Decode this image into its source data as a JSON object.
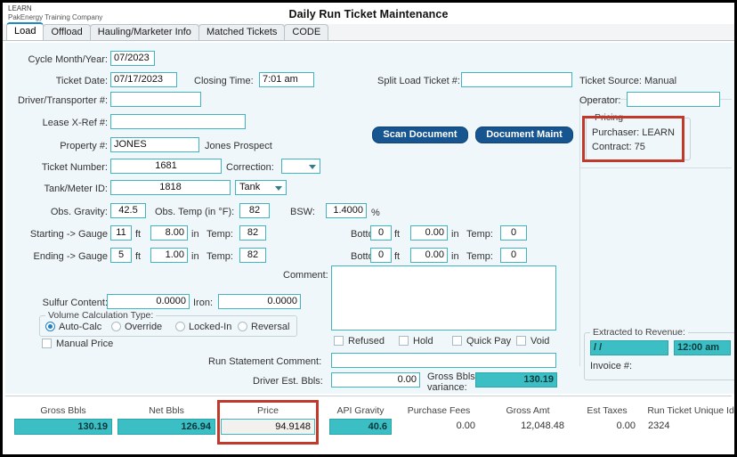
{
  "header": {
    "company_code": "LEARN",
    "company_name": "PakEnergy Training Company",
    "title": "Daily Run Ticket Maintenance"
  },
  "tabs": [
    {
      "label": "Load",
      "active": true
    },
    {
      "label": "Offload",
      "active": false
    },
    {
      "label": "Hauling/Marketer Info",
      "active": false
    },
    {
      "label": "Matched Tickets",
      "active": false
    },
    {
      "label": "CODE",
      "active": false
    }
  ],
  "form": {
    "cycle_month_year_label": "Cycle Month/Year:",
    "cycle_month_year_value": "07/2023",
    "ticket_date_label": "Ticket Date:",
    "ticket_date_value": "07/17/2023",
    "closing_time_label": "Closing Time:",
    "closing_time_value": "7:01 am",
    "driver_transporter_label": "Driver/Transporter #:",
    "driver_transporter_value": "",
    "lease_xref_label": "Lease X-Ref #:",
    "lease_xref_value": "",
    "property_label": "Property #:",
    "property_value": "JONES",
    "property_name": "Jones Prospect",
    "ticket_number_label": "Ticket Number:",
    "ticket_number_value": "1681",
    "correction_label": "Correction:",
    "correction_value": "",
    "tank_meter_label": "Tank/Meter ID:",
    "tank_meter_value": "1818",
    "tank_type_value": "Tank",
    "obs_gravity_label": "Obs. Gravity:",
    "obs_gravity_value": "42.5",
    "obs_temp_label": "Obs. Temp (in °F):",
    "obs_temp_value": "82",
    "bsw_label": "BSW:",
    "bsw_value": "1.4000",
    "bsw_unit": "%",
    "starting_gauge_label": "Starting -> Gauge",
    "starting_ft": "11",
    "starting_ft_unit": "ft",
    "starting_in": "8.00",
    "starting_in_unit": "in",
    "starting_temp_label": "Temp:",
    "starting_temp": "82",
    "starting_bottom_label": "Bottom:",
    "starting_bottom_ft": "0",
    "starting_bottom_in": "0.00",
    "starting_bottom_temp": "0",
    "ending_gauge_label": "Ending -> Gauge",
    "ending_ft": "5",
    "ending_ft_unit": "ft",
    "ending_in": "1.00",
    "ending_in_unit": "in",
    "ending_temp_label": "Temp:",
    "ending_temp": "82",
    "ending_bottom_label": "Bottom:",
    "ending_bottom_ft": "0",
    "ending_bottom_in": "0.00",
    "ending_bottom_temp": "0",
    "sulfur_label": "Sulfur Content:",
    "sulfur_value": "0.0000",
    "iron_label": "Iron:",
    "iron_value": "0.0000",
    "volume_calc_caption": "Volume Calculation Type:",
    "volume_options": [
      {
        "label": "Auto-Calc",
        "selected": true
      },
      {
        "label": "Override",
        "selected": false
      },
      {
        "label": "Locked-In",
        "selected": false
      },
      {
        "label": "Reversal",
        "selected": false
      }
    ],
    "manual_price_label": "Manual Price",
    "manual_price_checked": false,
    "comment_label": "Comment:",
    "comment_value": "",
    "status_checkboxes": [
      {
        "label": "Refused",
        "checked": false
      },
      {
        "label": "Hold",
        "checked": false
      },
      {
        "label": "Quick Pay",
        "checked": false
      },
      {
        "label": "Void",
        "checked": false
      }
    ],
    "run_statement_comment_label": "Run Statement Comment:",
    "run_statement_comment_value": "",
    "driver_est_bbls_label": "Driver Est. Bbls:",
    "driver_est_bbls_value": "0.00",
    "gross_bbls_variance_label_1": "Gross Bbls",
    "gross_bbls_variance_label_2": "variance:",
    "gross_bbls_variance_value": "130.19",
    "split_load_label": "Split Load Ticket #:",
    "split_load_value": "",
    "ticket_source_label": "Ticket Source: Manual",
    "operator_label": "Operator:",
    "operator_value": "",
    "scan_document_label": "Scan Document",
    "document_maint_label": "Document Maint"
  },
  "pricing": {
    "caption": "Pricing",
    "purchaser": "Purchaser: LEARN",
    "contract": "Contract: 75"
  },
  "extracted": {
    "caption": "Extracted to Revenue:",
    "date_value": "  /  /",
    "time_value": "12:00 am",
    "invoice_label": "Invoice #:"
  },
  "summary": [
    {
      "head": "Gross Bbls",
      "value": "130.19",
      "style": "box"
    },
    {
      "head": "Net Bbls",
      "value": "126.94",
      "style": "box"
    },
    {
      "head": "Price",
      "value": "94.9148",
      "style": "boxw"
    },
    {
      "head": "API Gravity",
      "value": "40.6",
      "style": "box"
    },
    {
      "head": "Purchase Fees",
      "value": "0.00",
      "style": "plain"
    },
    {
      "head": "Gross Amt",
      "value": "12,048.48",
      "style": "plain"
    },
    {
      "head": "Est Taxes",
      "value": "0.00",
      "style": "plain"
    },
    {
      "head": "Run Ticket Unique Id#",
      "value": "2324",
      "style": "plainleft"
    }
  ],
  "colors": {
    "field_border": "#40b5bf",
    "teal_fill": "#3bbfc4",
    "button_blue": "#16558f",
    "highlight_red": "#c0392b",
    "form_background": "#f0f7fa"
  }
}
